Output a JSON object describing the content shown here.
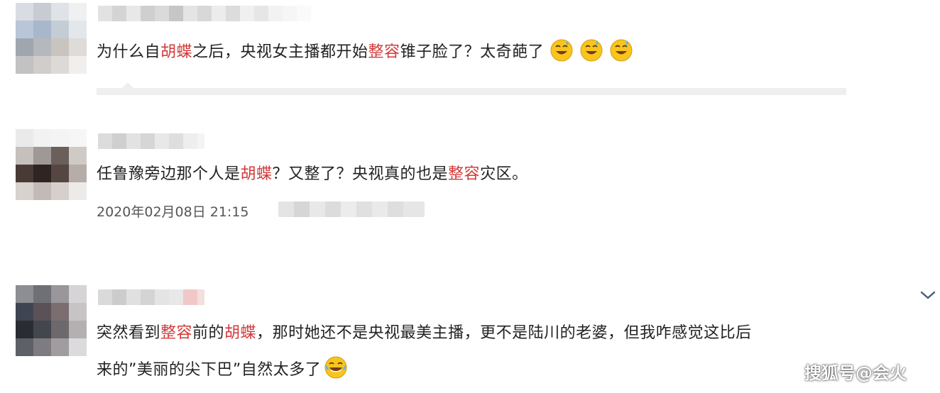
{
  "comments": [
    {
      "id": "c1",
      "text_parts": [
        {
          "t": "为什么自",
          "hl": false
        },
        {
          "t": "胡蝶",
          "hl": true
        },
        {
          "t": "之后，央视女主播都开始",
          "hl": false
        },
        {
          "t": "整容",
          "hl": true
        },
        {
          "t": "锥子脸了？太奇葩了",
          "hl": false
        }
      ],
      "emoji_count": 3,
      "emoji": "grinning-sweat-emoji",
      "timestamp": ""
    },
    {
      "id": "c2",
      "text_parts": [
        {
          "t": "任鲁豫旁边那个人是",
          "hl": false
        },
        {
          "t": "胡蝶",
          "hl": true
        },
        {
          "t": "？又整了？央视真的也是",
          "hl": false
        },
        {
          "t": "整容",
          "hl": true
        },
        {
          "t": "灾区。",
          "hl": false
        }
      ],
      "timestamp": "2020年02月08日 21:15"
    },
    {
      "id": "c3",
      "line1_parts": [
        {
          "t": "突然看到",
          "hl": false
        },
        {
          "t": "整容",
          "hl": true
        },
        {
          "t": "前的",
          "hl": false
        },
        {
          "t": "胡蝶",
          "hl": true
        },
        {
          "t": "，那时她还不是央视最美主播，更不是陆川的老婆，但我咋感觉这比后",
          "hl": false
        }
      ],
      "line2_parts": [
        {
          "t": "来的”美丽的尖下巴”自然太多了",
          "hl": false
        }
      ],
      "emoji": "tears-of-joy-emoji"
    }
  ],
  "colors": {
    "highlight": "#d33a3a",
    "text": "#222222",
    "timestamp": "#555555",
    "divider": "#eeeeee",
    "emoji_yellow": "#f7c51e"
  },
  "icons": {
    "expand": "chevron-down-icon"
  },
  "watermark": "搜狐号@会火"
}
